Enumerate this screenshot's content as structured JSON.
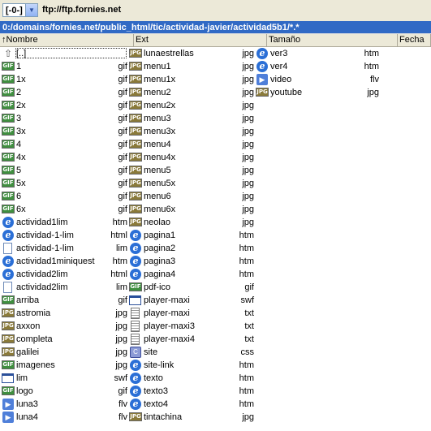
{
  "toolbar": {
    "drive": "[-0-]",
    "ftp": "ftp://ftp.fornies.net"
  },
  "path": "0:/domains/fornies.net/public_html/tic/actividad-javier/actividad5b1/*.*",
  "headers": {
    "name": "↑Nombre",
    "ext": "Ext",
    "size": "Tamaño",
    "date": "Fecha"
  },
  "columns": [
    [
      {
        "name": "[..]",
        "ext": "",
        "icon": "up"
      },
      {
        "name": "1",
        "ext": "gif",
        "icon": "gif"
      },
      {
        "name": "1x",
        "ext": "gif",
        "icon": "gif"
      },
      {
        "name": "2",
        "ext": "gif",
        "icon": "gif"
      },
      {
        "name": "2x",
        "ext": "gif",
        "icon": "gif"
      },
      {
        "name": "3",
        "ext": "gif",
        "icon": "gif"
      },
      {
        "name": "3x",
        "ext": "gif",
        "icon": "gif"
      },
      {
        "name": "4",
        "ext": "gif",
        "icon": "gif"
      },
      {
        "name": "4x",
        "ext": "gif",
        "icon": "gif"
      },
      {
        "name": "5",
        "ext": "gif",
        "icon": "gif"
      },
      {
        "name": "5x",
        "ext": "gif",
        "icon": "gif"
      },
      {
        "name": "6",
        "ext": "gif",
        "icon": "gif"
      },
      {
        "name": "6x",
        "ext": "gif",
        "icon": "gif"
      },
      {
        "name": "actividad1lim",
        "ext": "htm",
        "icon": "htm"
      },
      {
        "name": "actividad-1-lim",
        "ext": "html",
        "icon": "htm"
      },
      {
        "name": "actividad-1-lim",
        "ext": "lim",
        "icon": "lim"
      },
      {
        "name": "actividad1miniquest",
        "ext": "htm",
        "icon": "htm"
      },
      {
        "name": "actividad2lim",
        "ext": "html",
        "icon": "htm"
      },
      {
        "name": "actividad2lim",
        "ext": "lim",
        "icon": "lim"
      },
      {
        "name": "arriba",
        "ext": "gif",
        "icon": "gif"
      },
      {
        "name": "astromia",
        "ext": "jpg",
        "icon": "jpg"
      },
      {
        "name": "axxon",
        "ext": "jpg",
        "icon": "jpg"
      },
      {
        "name": "completa",
        "ext": "jpg",
        "icon": "jpg"
      },
      {
        "name": "galilei",
        "ext": "jpg",
        "icon": "jpg"
      },
      {
        "name": "imagenes",
        "ext": "jpg",
        "icon": "gif"
      },
      {
        "name": "lim",
        "ext": "swf",
        "icon": "swf"
      },
      {
        "name": "logo",
        "ext": "gif",
        "icon": "gif"
      },
      {
        "name": "luna3",
        "ext": "flv",
        "icon": "flv"
      },
      {
        "name": "luna4",
        "ext": "flv",
        "icon": "flv"
      }
    ],
    [
      {
        "name": "lunaestrellas",
        "ext": "jpg",
        "icon": "jpg"
      },
      {
        "name": "menu1",
        "ext": "jpg",
        "icon": "jpg"
      },
      {
        "name": "menu1x",
        "ext": "jpg",
        "icon": "jpg"
      },
      {
        "name": "menu2",
        "ext": "jpg",
        "icon": "jpg"
      },
      {
        "name": "menu2x",
        "ext": "jpg",
        "icon": "jpg"
      },
      {
        "name": "menu3",
        "ext": "jpg",
        "icon": "jpg"
      },
      {
        "name": "menu3x",
        "ext": "jpg",
        "icon": "jpg"
      },
      {
        "name": "menu4",
        "ext": "jpg",
        "icon": "jpg"
      },
      {
        "name": "menu4x",
        "ext": "jpg",
        "icon": "jpg"
      },
      {
        "name": "menu5",
        "ext": "jpg",
        "icon": "jpg"
      },
      {
        "name": "menu5x",
        "ext": "jpg",
        "icon": "jpg"
      },
      {
        "name": "menu6",
        "ext": "jpg",
        "icon": "jpg"
      },
      {
        "name": "menu6x",
        "ext": "jpg",
        "icon": "jpg"
      },
      {
        "name": "neolao",
        "ext": "jpg",
        "icon": "jpg"
      },
      {
        "name": "pagina1",
        "ext": "htm",
        "icon": "htm"
      },
      {
        "name": "pagina2",
        "ext": "htm",
        "icon": "htm"
      },
      {
        "name": "pagina3",
        "ext": "htm",
        "icon": "htm"
      },
      {
        "name": "pagina4",
        "ext": "htm",
        "icon": "htm"
      },
      {
        "name": "pdf-ico",
        "ext": "gif",
        "icon": "gif"
      },
      {
        "name": "player-maxi",
        "ext": "swf",
        "icon": "swf"
      },
      {
        "name": "player-maxi",
        "ext": "txt",
        "icon": "txt"
      },
      {
        "name": "player-maxi3",
        "ext": "txt",
        "icon": "txt"
      },
      {
        "name": "player-maxi4",
        "ext": "txt",
        "icon": "txt"
      },
      {
        "name": "site",
        "ext": "css",
        "icon": "css"
      },
      {
        "name": "site-link",
        "ext": "htm",
        "icon": "htm"
      },
      {
        "name": "texto",
        "ext": "htm",
        "icon": "htm"
      },
      {
        "name": "texto3",
        "ext": "htm",
        "icon": "htm"
      },
      {
        "name": "texto4",
        "ext": "htm",
        "icon": "htm"
      },
      {
        "name": "tintachina",
        "ext": "jpg",
        "icon": "jpg"
      }
    ],
    [
      {
        "name": "ver3",
        "ext": "htm",
        "icon": "htm"
      },
      {
        "name": "ver4",
        "ext": "htm",
        "icon": "htm"
      },
      {
        "name": "video",
        "ext": "flv",
        "icon": "flv"
      },
      {
        "name": "youtube",
        "ext": "jpg",
        "icon": "jpg"
      }
    ]
  ]
}
